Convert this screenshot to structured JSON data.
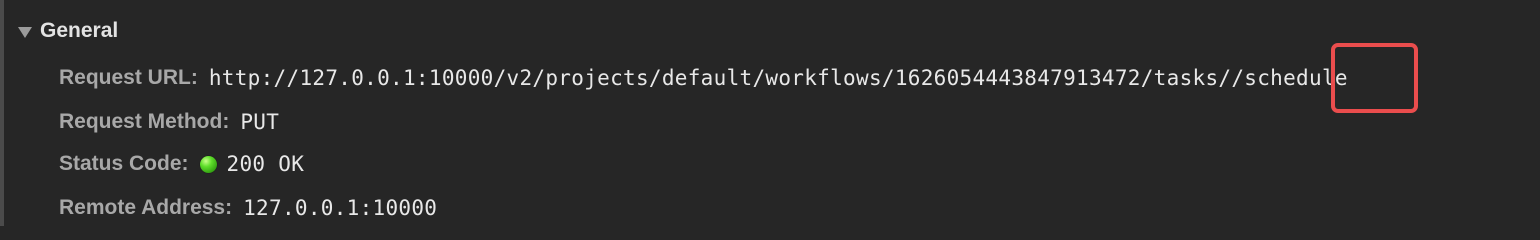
{
  "general": {
    "title": "General"
  },
  "rows": [
    {
      "key": "Request URL:",
      "value": "http://127.0.0.1:10000/v2/projects/default/workflows/1626054443847913472/tasks//schedule"
    },
    {
      "key": "Request Method:",
      "value": "PUT"
    },
    {
      "key": "Status Code:",
      "value": "200 OK",
      "status_color": "#4fd11f"
    },
    {
      "key": "Remote Address:",
      "value": "127.0.0.1:10000"
    }
  ],
  "annotation": {
    "highlight_color": "#ea4d4d"
  },
  "icons": {
    "disclosure": "triangle-down-icon",
    "status": "green-dot-icon"
  }
}
